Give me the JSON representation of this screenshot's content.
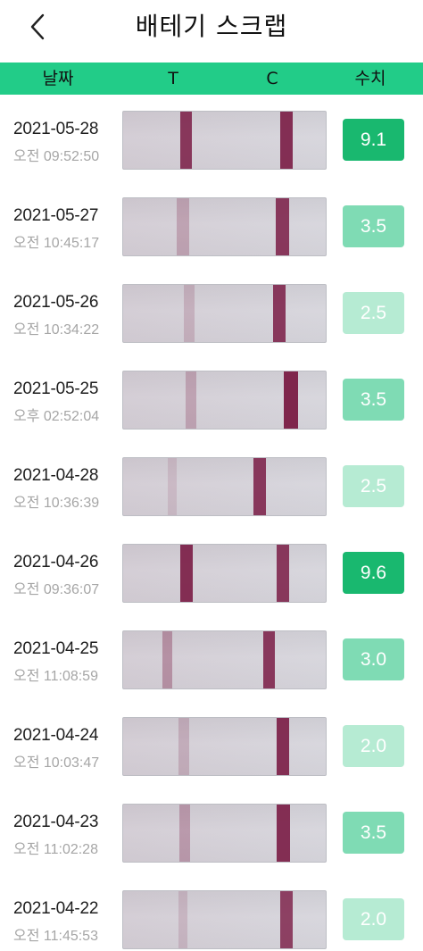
{
  "header": {
    "title": "배테기 스크랩",
    "back_icon": "chevron-left-icon"
  },
  "columns": {
    "date": "날짜",
    "t": "T",
    "c": "C",
    "value": "수치"
  },
  "colors": {
    "header_bg": "#22cc88",
    "badge_high": "#19b86f",
    "badge_mid": "#7fdbb4",
    "badge_low": "#b6ebd3"
  },
  "rows": [
    {
      "date": "2021-05-28",
      "time": "오전 09:52:50",
      "value": "9.1",
      "level": "high"
    },
    {
      "date": "2021-05-27",
      "time": "오전 10:45:17",
      "value": "3.5",
      "level": "mid"
    },
    {
      "date": "2021-05-26",
      "time": "오전 10:34:22",
      "value": "2.5",
      "level": "low"
    },
    {
      "date": "2021-05-25",
      "time": "오후 02:52:04",
      "value": "3.5",
      "level": "mid"
    },
    {
      "date": "2021-04-28",
      "time": "오전 10:36:39",
      "value": "2.5",
      "level": "low"
    },
    {
      "date": "2021-04-26",
      "time": "오전 09:36:07",
      "value": "9.6",
      "level": "high"
    },
    {
      "date": "2021-04-25",
      "time": "오전 11:08:59",
      "value": "3.0",
      "level": "mid"
    },
    {
      "date": "2021-04-24",
      "time": "오전 10:03:47",
      "value": "2.0",
      "level": "low"
    },
    {
      "date": "2021-04-23",
      "time": "오전 11:02:28",
      "value": "3.5",
      "level": "mid"
    },
    {
      "date": "2021-04-22",
      "time": "오전 11:45:53",
      "value": "2.0",
      "level": "low"
    }
  ]
}
